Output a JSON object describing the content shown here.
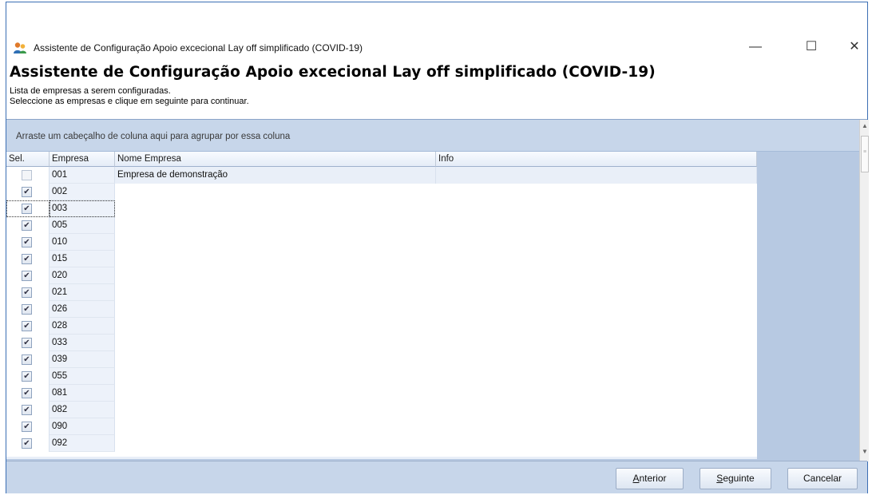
{
  "window": {
    "title": "Assistente de Configuração Apoio excecional Lay off simplificado (COVID-19)",
    "minimize_glyph": "—",
    "maximize_glyph": "☐",
    "close_glyph": "✕"
  },
  "header": {
    "title": "Assistente de Configuração Apoio excecional Lay off simplificado (COVID-19)",
    "line1": "Lista de empresas a serem configuradas.",
    "line2": "Seleccione as empresas e clique em seguinte para continuar."
  },
  "grid": {
    "group_panel_text": "Arraste um cabeçalho de coluna aqui para agrupar por essa coluna",
    "columns": [
      "Sel.",
      "Empresa",
      "Nome Empresa",
      "Info"
    ],
    "rows": [
      {
        "sel": false,
        "empresa": "001",
        "nome": "Empresa de demonstração",
        "info": ""
      },
      {
        "sel": true,
        "empresa": "002",
        "nome": "",
        "info": ""
      },
      {
        "sel": true,
        "empresa": "003",
        "nome": "",
        "info": ""
      },
      {
        "sel": true,
        "empresa": "005",
        "nome": "",
        "info": ""
      },
      {
        "sel": true,
        "empresa": "010",
        "nome": "",
        "info": ""
      },
      {
        "sel": true,
        "empresa": "015",
        "nome": "",
        "info": ""
      },
      {
        "sel": true,
        "empresa": "020",
        "nome": "",
        "info": ""
      },
      {
        "sel": true,
        "empresa": "021",
        "nome": "",
        "info": ""
      },
      {
        "sel": true,
        "empresa": "026",
        "nome": "",
        "info": ""
      },
      {
        "sel": true,
        "empresa": "028",
        "nome": "",
        "info": ""
      },
      {
        "sel": true,
        "empresa": "033",
        "nome": "",
        "info": ""
      },
      {
        "sel": true,
        "empresa": "039",
        "nome": "",
        "info": ""
      },
      {
        "sel": true,
        "empresa": "055",
        "nome": "",
        "info": ""
      },
      {
        "sel": true,
        "empresa": "081",
        "nome": "",
        "info": ""
      },
      {
        "sel": true,
        "empresa": "082",
        "nome": "",
        "info": ""
      },
      {
        "sel": true,
        "empresa": "090",
        "nome": "",
        "info": ""
      },
      {
        "sel": true,
        "empresa": "092",
        "nome": "",
        "info": ""
      }
    ],
    "focused_empresa": "003",
    "checked_glyph": "✔"
  },
  "footer": {
    "anterior_accel": "A",
    "anterior_rest": "nterior",
    "seguinte_accel": "S",
    "seguinte_rest": "eguinte",
    "cancelar_label": "Cancelar"
  },
  "colors": {
    "accent": "#3b6fb4",
    "panel": "#c7d6ea",
    "grid_bg": "#b7c9e2"
  }
}
